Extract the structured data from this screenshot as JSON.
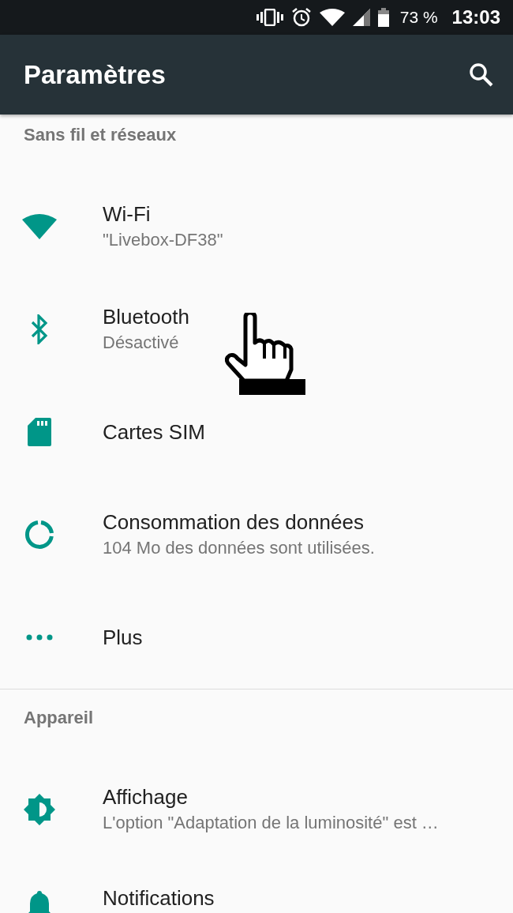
{
  "status_bar": {
    "battery": "73 %",
    "time": "13:03"
  },
  "toolbar": {
    "title": "Paramètres"
  },
  "sections": [
    {
      "header": "Sans fil et réseaux",
      "items": [
        {
          "kind": "wifi",
          "title": "Wi-Fi",
          "summary": "\"Livebox-DF38\""
        },
        {
          "kind": "bluetooth",
          "title": "Bluetooth",
          "summary": "Désactivé"
        },
        {
          "kind": "sim",
          "title": "Cartes SIM"
        },
        {
          "kind": "data",
          "title": "Consommation des données",
          "summary": "104 Mo des données sont utilisées."
        },
        {
          "kind": "more",
          "title": "Plus"
        }
      ]
    },
    {
      "header": "Appareil",
      "items": [
        {
          "kind": "display",
          "title": "Affichage",
          "summary": "L'option \"Adaptation de la luminosité\" est …"
        },
        {
          "kind": "bell",
          "title": "Notifications"
        }
      ]
    }
  ]
}
